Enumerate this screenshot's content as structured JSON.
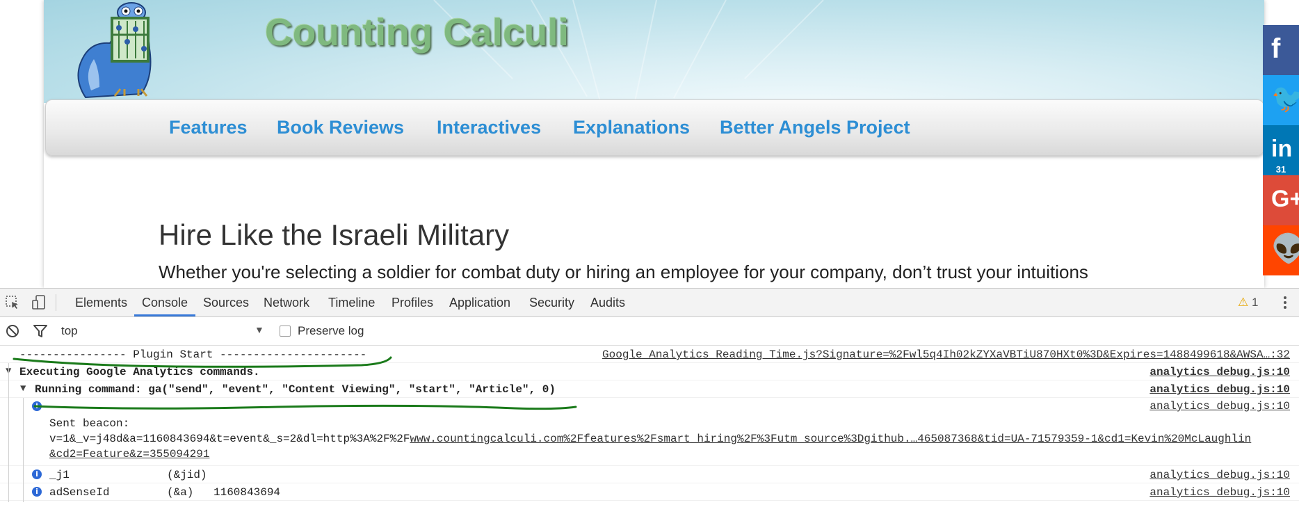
{
  "site": {
    "title": "Counting Calculi",
    "nav": [
      "Features",
      "Book Reviews",
      "Interactives",
      "Explanations",
      "Better Angels Project"
    ],
    "article_title": "Hire Like the Israeli Military",
    "article_sub": "Whether you're selecting a soldier for combat duty or hiring an employee for your company, don’t trust your intuitions"
  },
  "social": {
    "items": [
      {
        "name": "facebook-share",
        "glyph": "f",
        "color": "#3b5998",
        "count": ""
      },
      {
        "name": "twitter-share",
        "glyph": "🐦",
        "color": "#1da1f2",
        "count": ""
      },
      {
        "name": "linkedin-share",
        "glyph": "in",
        "color": "#0077b5",
        "count": "31"
      },
      {
        "name": "googleplus-share",
        "glyph": "G+",
        "color": "#dd4b39",
        "count": ""
      },
      {
        "name": "reddit-share",
        "glyph": "👽",
        "color": "#ff4500",
        "count": ""
      }
    ]
  },
  "devtools": {
    "tabs": [
      "Elements",
      "Console",
      "Sources",
      "Network",
      "Timeline",
      "Profiles",
      "Application",
      "Security",
      "Audits"
    ],
    "active_tab": "Console",
    "warning_count": "1",
    "context": "top",
    "preserve_log": "Preserve log",
    "accent": "#3879d9"
  },
  "console": {
    "plugin_start": "---------------- Plugin Start ----------------------",
    "plugin_src": "Google_Analytics_Reading_Time.js?Signature=%2Fwl5q4Ih02kZYXaVBTiU870HXt0%3D&Expires=1488499618&AWSA…:32",
    "exec": "Executing Google Analytics commands.",
    "exec_src": "analytics_debug.js:10",
    "run": "Running command: ga(\"send\", \"event\", \"Content Viewing\", \"start\", \"Article\", 0)",
    "run_src": "analytics_debug.js:10",
    "info_src": "analytics_debug.js:10",
    "beacon_label": "Sent beacon:",
    "beacon_plain": "v=1&_v=j48d&a=1160843694&t=event&_s=2&dl=http%3A%2F%2F",
    "beacon_link1": "www.countingcalculi.com%2Ffeatures%2Fsmart_hiring%2F%3Futm_source%3Dgithub.…465087368&tid=UA-71579359-1&cd1=Kevin%20McLaughlin",
    "beacon_link2": "&cd2=Feature&z=355094291",
    "rows": [
      {
        "key": "_j1",
        "param": "(&jid)",
        "value": "",
        "src": "analytics_debug.js:10"
      },
      {
        "key": "adSenseId",
        "param": "(&a)",
        "value": "1160843694",
        "src": "analytics_debug.js:10"
      }
    ]
  }
}
